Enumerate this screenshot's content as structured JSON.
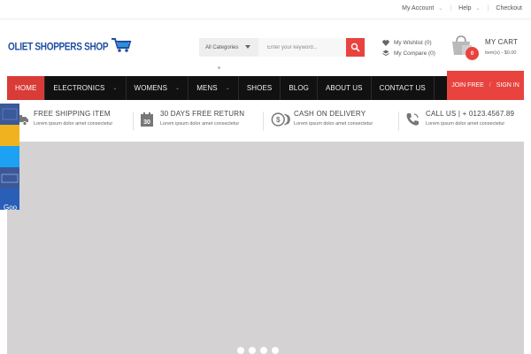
{
  "topbar": {
    "my_account": "My Account",
    "help": "Help",
    "checkout": "Checkout",
    "separator": "|"
  },
  "header": {
    "logo_text": "OLIET SHOPPERS SHOP",
    "search_category": "All Categories",
    "search_placeholder": "Enter your keyword...",
    "wishlist": "My Wishlist (0)",
    "compare": "My Compare (0)",
    "cart_title": "MY CART",
    "cart_count": "0",
    "cart_summary": "item(s) - $0.00"
  },
  "nav": {
    "items": [
      {
        "label": "HOME",
        "active": true,
        "dropdown": false
      },
      {
        "label": "ELECTRONICS",
        "active": false,
        "dropdown": true
      },
      {
        "label": "WOMENS",
        "active": false,
        "dropdown": true
      },
      {
        "label": "MENS",
        "active": false,
        "dropdown": true
      },
      {
        "label": "SHOES",
        "active": false,
        "dropdown": false
      },
      {
        "label": "BLOG",
        "active": false,
        "dropdown": false
      },
      {
        "label": "ABOUT US",
        "active": false,
        "dropdown": false
      },
      {
        "label": "CONTACT US",
        "active": false,
        "dropdown": false
      }
    ],
    "join": "JOIN FREE",
    "sep": "/",
    "signin": "SIGN IN"
  },
  "features": [
    {
      "title": "FREE SHIPPING ITEM",
      "sub": "Lorem ipsum dolor amet consectetur",
      "icon": "truck-icon"
    },
    {
      "title": "30 DAYS FREE RETURN",
      "sub": "Lorem ipsum dolor amet consectetur",
      "icon": "calendar-30-icon"
    },
    {
      "title": "CASH ON DELIVERY",
      "sub": "Lorem ipsum dolor amet consectetur",
      "icon": "coins-icon"
    },
    {
      "title": "CALL US | + 0123.4567.89",
      "sub": "Lorem ipsum dolor amet consectetur",
      "icon": "phone-icon"
    }
  ],
  "social": {
    "google_label": "Goo"
  },
  "colors": {
    "accent": "#e8433e",
    "nav_bg": "#111111",
    "logo_blue": "#1f4fa3",
    "slider_bg": "#d4d2d2",
    "facebook": "#3b5998",
    "twitter": "#1da1f2"
  },
  "slider": {
    "dot_count": 4
  }
}
